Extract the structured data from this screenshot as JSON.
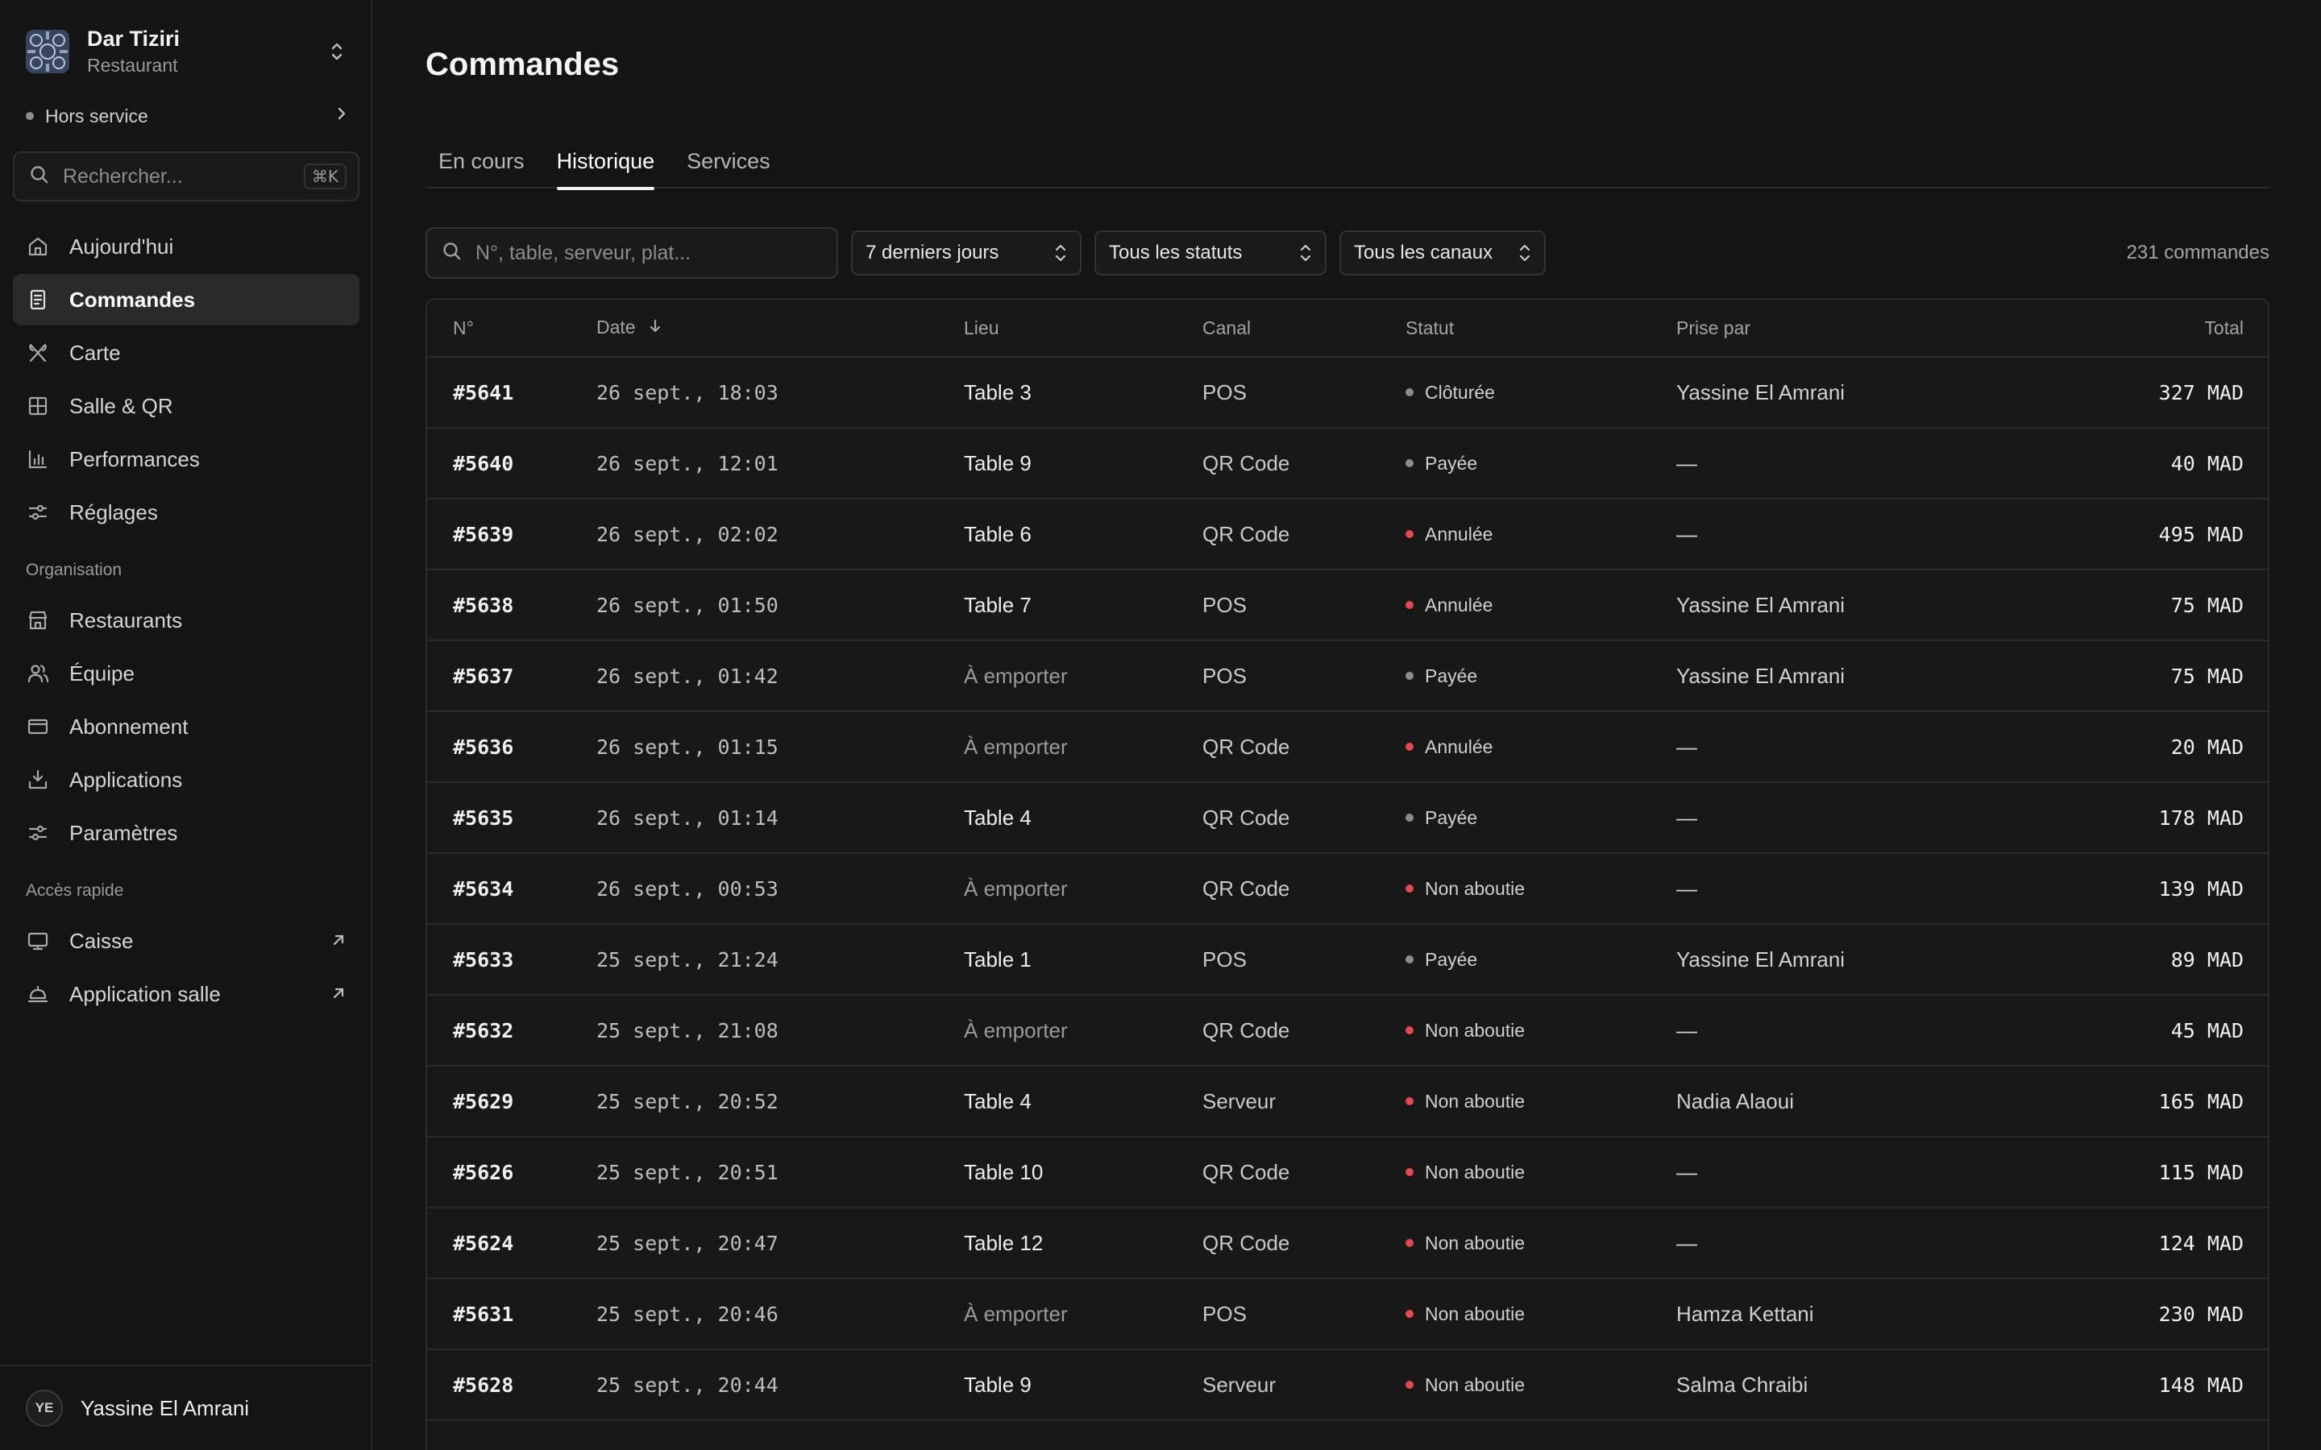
{
  "sidebar": {
    "org_name": "Dar Tiziri",
    "org_type": "Restaurant",
    "service_status": "Hors service",
    "search_placeholder": "Rechercher...",
    "search_shortcut": "⌘K",
    "nav": [
      {
        "label": "Aujourd'hui",
        "icon": "home-icon"
      },
      {
        "label": "Commandes",
        "icon": "receipt-icon",
        "active": true
      },
      {
        "label": "Carte",
        "icon": "utensils-icon"
      },
      {
        "label": "Salle & QR",
        "icon": "grid-icon"
      },
      {
        "label": "Performances",
        "icon": "bar-chart-icon"
      },
      {
        "label": "Réglages",
        "icon": "sliders-icon"
      }
    ],
    "org_section_title": "Organisation",
    "org_nav": [
      {
        "label": "Restaurants",
        "icon": "store-icon"
      },
      {
        "label": "Équipe",
        "icon": "users-icon"
      },
      {
        "label": "Abonnement",
        "icon": "credit-card-icon"
      },
      {
        "label": "Applications",
        "icon": "download-icon"
      },
      {
        "label": "Paramètres",
        "icon": "settings-sliders-icon"
      }
    ],
    "quick_section_title": "Accès rapide",
    "quick_nav": [
      {
        "label": "Caisse",
        "icon": "monitor-icon"
      },
      {
        "label": "Application salle",
        "icon": "cloche-icon"
      }
    ],
    "user": {
      "initials": "YE",
      "name": "Yassine El Amrani"
    }
  },
  "main": {
    "title": "Commandes",
    "tabs": [
      "En cours",
      "Historique",
      "Services"
    ],
    "active_tab": 1,
    "filters": {
      "search_placeholder": "N°, table, serveur, plat...",
      "period": "7 derniers jours",
      "status": "Tous les statuts",
      "channel": "Tous les canaux",
      "count": "231 commandes"
    },
    "columns": [
      "N°",
      "Date",
      "Lieu",
      "Canal",
      "Statut",
      "Prise par",
      "Total"
    ],
    "rows": [
      {
        "num": "#5641",
        "date": "26 sept., 18:03",
        "lieu": "Table 3",
        "canal": "POS",
        "statut": "Clôturée",
        "prise": "Yassine El Amrani",
        "total": "327 MAD"
      },
      {
        "num": "#5640",
        "date": "26 sept., 12:01",
        "lieu": "Table 9",
        "canal": "QR Code",
        "statut": "Payée",
        "prise": "—",
        "total": "40 MAD"
      },
      {
        "num": "#5639",
        "date": "26 sept., 02:02",
        "lieu": "Table 6",
        "canal": "QR Code",
        "statut": "Annulée",
        "prise": "—",
        "total": "495 MAD"
      },
      {
        "num": "#5638",
        "date": "26 sept., 01:50",
        "lieu": "Table 7",
        "canal": "POS",
        "statut": "Annulée",
        "prise": "Yassine El Amrani",
        "total": "75 MAD"
      },
      {
        "num": "#5637",
        "date": "26 sept., 01:42",
        "lieu": "À emporter",
        "canal": "POS",
        "statut": "Payée",
        "prise": "Yassine El Amrani",
        "total": "75 MAD"
      },
      {
        "num": "#5636",
        "date": "26 sept., 01:15",
        "lieu": "À emporter",
        "canal": "QR Code",
        "statut": "Annulée",
        "prise": "—",
        "total": "20 MAD"
      },
      {
        "num": "#5635",
        "date": "26 sept., 01:14",
        "lieu": "Table 4",
        "canal": "QR Code",
        "statut": "Payée",
        "prise": "—",
        "total": "178 MAD"
      },
      {
        "num": "#5634",
        "date": "26 sept., 00:53",
        "lieu": "À emporter",
        "canal": "QR Code",
        "statut": "Non aboutie",
        "prise": "—",
        "total": "139 MAD"
      },
      {
        "num": "#5633",
        "date": "25 sept., 21:24",
        "lieu": "Table 1",
        "canal": "POS",
        "statut": "Payée",
        "prise": "Yassine El Amrani",
        "total": "89 MAD"
      },
      {
        "num": "#5632",
        "date": "25 sept., 21:08",
        "lieu": "À emporter",
        "canal": "QR Code",
        "statut": "Non aboutie",
        "prise": "—",
        "total": "45 MAD"
      },
      {
        "num": "#5629",
        "date": "25 sept., 20:52",
        "lieu": "Table 4",
        "canal": "Serveur",
        "statut": "Non aboutie",
        "prise": "Nadia Alaoui",
        "total": "165 MAD"
      },
      {
        "num": "#5626",
        "date": "25 sept., 20:51",
        "lieu": "Table 10",
        "canal": "QR Code",
        "statut": "Non aboutie",
        "prise": "—",
        "total": "115 MAD"
      },
      {
        "num": "#5624",
        "date": "25 sept., 20:47",
        "lieu": "Table 12",
        "canal": "QR Code",
        "statut": "Non aboutie",
        "prise": "—",
        "total": "124 MAD"
      },
      {
        "num": "#5631",
        "date": "25 sept., 20:46",
        "lieu": "À emporter",
        "canal": "POS",
        "statut": "Non aboutie",
        "prise": "Hamza Kettani",
        "total": "230 MAD"
      },
      {
        "num": "#5628",
        "date": "25 sept., 20:44",
        "lieu": "Table 9",
        "canal": "Serveur",
        "statut": "Non aboutie",
        "prise": "Salma Chraibi",
        "total": "148 MAD"
      }
    ],
    "status_colors": {
      "neutral": "#8c8c8c",
      "error": "#e5484d"
    }
  }
}
